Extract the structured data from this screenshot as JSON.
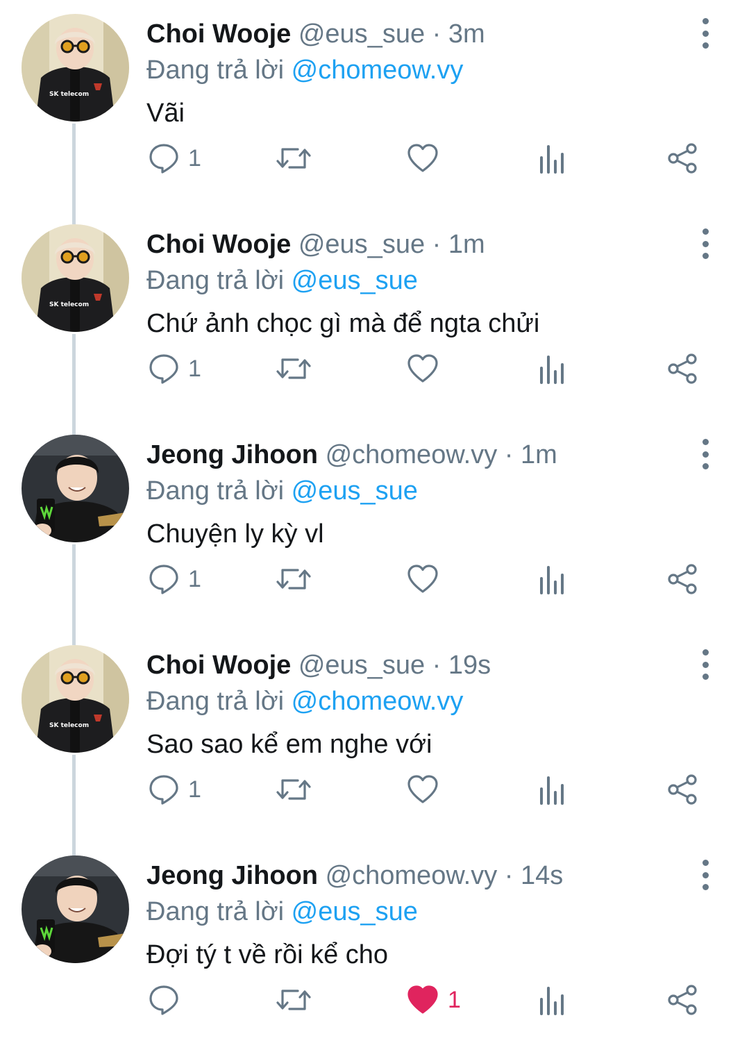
{
  "tweets": [
    {
      "name": "Choi Wooje",
      "handle": "@eus_sue",
      "time": "· 3m",
      "reply_prefix": "Đang trả lời",
      "reply_to": "@chomeow.vy",
      "text": "Vãi",
      "reply_count": "1",
      "like_count": "",
      "liked": false,
      "avatar": "wooje"
    },
    {
      "name": "Choi Wooje",
      "handle": "@eus_sue",
      "time": "· 1m",
      "reply_prefix": "Đang trả lời",
      "reply_to": "@eus_sue",
      "text": "Chứ ảnh chọc gì mà để ngta chửi",
      "reply_count": "1",
      "like_count": "",
      "liked": false,
      "avatar": "wooje"
    },
    {
      "name": "Jeong Jihoon",
      "handle": "@chomeow.vy",
      "time": "· 1m",
      "reply_prefix": "Đang trả lời",
      "reply_to": "@eus_sue",
      "text": "Chuyện ly kỳ vl",
      "reply_count": "1",
      "like_count": "",
      "liked": false,
      "avatar": "jihoon"
    },
    {
      "name": "Choi Wooje",
      "handle": "@eus_sue",
      "time": "· 19s",
      "reply_prefix": "Đang trả lời",
      "reply_to": "@chomeow.vy",
      "text": "Sao sao kể em nghe với",
      "reply_count": "1",
      "like_count": "",
      "liked": false,
      "avatar": "wooje"
    },
    {
      "name": "Jeong Jihoon",
      "handle": "@chomeow.vy",
      "time": "· 14s",
      "reply_prefix": "Đang trả lời",
      "reply_to": "@eus_sue",
      "text": "Đợi tý t về rồi kể cho",
      "reply_count": "",
      "like_count": "1",
      "liked": true,
      "avatar": "jihoon"
    }
  ],
  "avatar_labels": {
    "wooje": "SK telecom"
  },
  "colors": {
    "text": "#14171a",
    "secondary": "#657786",
    "link": "#1da1f2",
    "like": "#e0245e",
    "thread_line": "#ccd6dd"
  },
  "icons": {
    "reply": "reply-icon",
    "retweet": "retweet-icon",
    "like": "heart-icon",
    "analytics": "analytics-icon",
    "share": "share-icon",
    "more": "more-options-icon"
  }
}
